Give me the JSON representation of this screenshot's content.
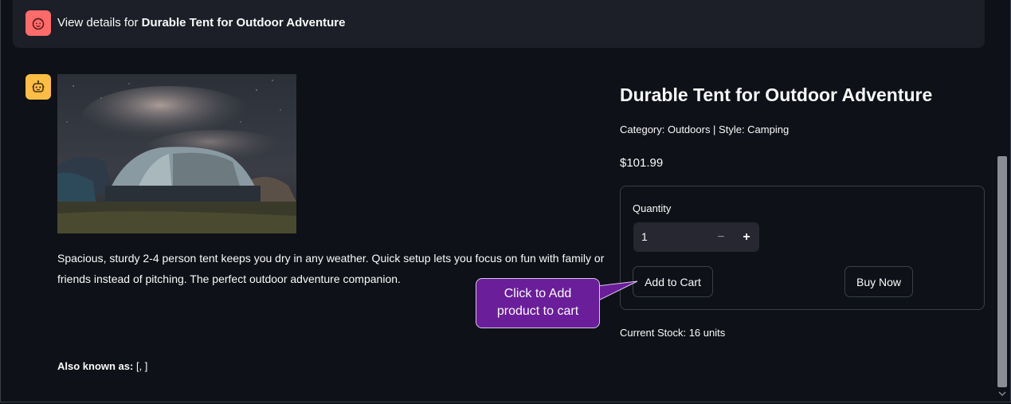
{
  "user_message": {
    "prefix": "View details for ",
    "product_name": "Durable Tent for Outdoor Adventure",
    "avatar_icon": "user-face-icon",
    "avatar_color": "#ff6b6b"
  },
  "assistant": {
    "avatar_icon": "robot-icon",
    "avatar_color": "#ffbd45"
  },
  "product": {
    "image_alt": "tent under night sky",
    "description": "Spacious, sturdy 2-4 person tent keeps you dry in any weather. Quick setup lets you focus on fun with family or friends instead of pitching. The perfect outdoor adventure companion.",
    "also_known_as_label": "Also known as:",
    "also_known_as_value": " [, ]",
    "title": "Durable Tent for Outdoor Adventure",
    "category_line": "Category: Outdoors | Style: Camping",
    "price": "$101.99",
    "stock": "Current Stock: 16 units"
  },
  "form": {
    "quantity_label": "Quantity",
    "quantity_value": "1",
    "minus_symbol": "−",
    "plus_symbol": "+",
    "add_to_cart_label": "Add to Cart",
    "buy_now_label": "Buy Now"
  },
  "callout": {
    "text_line1": "Click to Add",
    "text_line2": "product to cart",
    "color": "#6a1e9a"
  }
}
